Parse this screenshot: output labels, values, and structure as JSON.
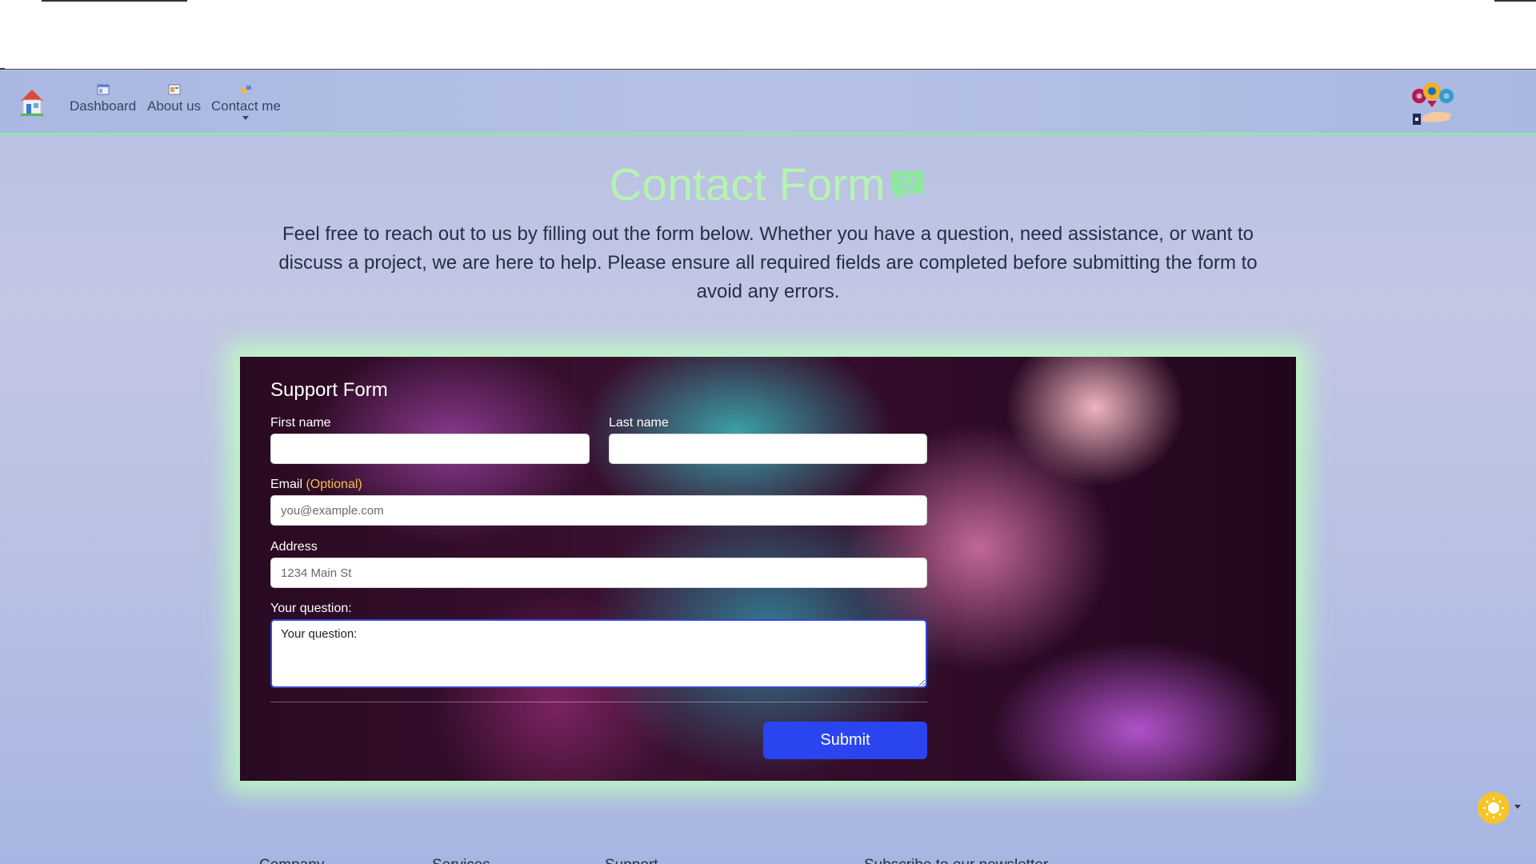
{
  "nav": {
    "items": [
      {
        "label": "Dashboard",
        "icon": "dashboard-icon"
      },
      {
        "label": "About us",
        "icon": "about-icon"
      },
      {
        "label": "Contact me",
        "icon": "contact-icon"
      }
    ],
    "home_icon": "home-icon",
    "brand_icon": "gears-hand-icon"
  },
  "hero": {
    "title": "Contact Form",
    "title_icon": "chat-bubble-icon",
    "intro": "Feel free to reach out to us by filling out the form below. Whether you have a question, need assistance, or want to discuss a project, we are here to help. Please ensure all required fields are completed before submitting the form to avoid any errors."
  },
  "form": {
    "title": "Support Form",
    "first_name_label": "First name",
    "first_name_value": "",
    "last_name_label": "Last name",
    "last_name_value": "",
    "email_label": "Email",
    "email_optional": "(Optional)",
    "email_placeholder": "you@example.com",
    "address_label": "Address",
    "address_placeholder": "1234 Main St",
    "question_label": "Your question:",
    "question_value": "Your question:",
    "submit_label": "Submit"
  },
  "footer": {
    "columns": [
      "Company",
      "Services",
      "Support",
      "Subscribe to our newsletter"
    ]
  },
  "colors": {
    "title_green": "#b6f3b0",
    "submit_blue": "#2a45f0",
    "optional_yellow": "#f4c04a",
    "toggle_yellow": "#f5c62a"
  }
}
